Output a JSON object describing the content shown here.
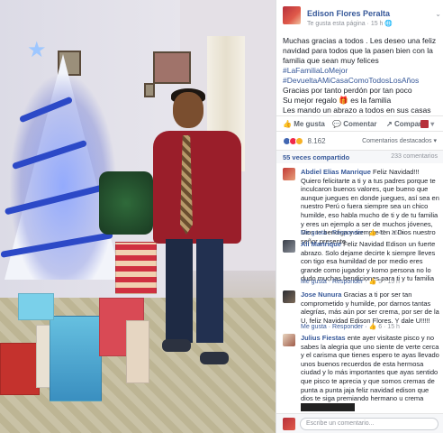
{
  "header": {
    "author": "Edison Flores Peralta",
    "meta": "Te gusta esta página · 15 h",
    "globe_icon": "globe-icon"
  },
  "post": {
    "line1": "Muchas gracias a todos . Les deseo una feliz navidad para todos que la pasen bien con la familia que sean muy felices",
    "hashtag1": "#LaFamiliaLoMejor",
    "hashtag2": "#DevueltaAMiCasaComoTodosLosAños",
    "line2": "Gracias por tanto perdón por tan poco",
    "line3": "Su mejor regalo 🎁 es la familia",
    "line4": "Les mando un abrazo a todos en sus casas"
  },
  "actions": {
    "like": "Me gusta",
    "comment": "Comentar",
    "share": "Compartir"
  },
  "reactions": {
    "count": "8.162",
    "sort_label": "Comentarios destacados"
  },
  "comments_bar": {
    "previous": "55 veces compartido",
    "count": "233 comentarios"
  },
  "comments": [
    {
      "name": "Abdiel Elias Manrique",
      "text": "Feliz Navidad!!! Quiero felicitarte a ti y a tus padres porque te inculcaron buenos valores, que bueno que aunque juegues en donde juegues, así sea en nuestro Perú o fuera siempre sea un chico humilde, eso habla mucho de ti y de tu familia y eres un ejemplo a ser de muchos jóvenes, Dios te bendiga y siempre ten a Dios nuestro señor presente",
      "like": "Me gusta",
      "reply": "Responder",
      "count": "49",
      "time": "15 h"
    },
    {
      "name": "Ali Manrique",
      "text": "Feliz Navidad Edison un fuerte abrazo. Solo dejame decirte k siempre lleves con tigo esa humildad de por medio eres grande como jugador y komo persona no lo dudo muchas bendiciones para ti y tu familia",
      "like": "Me gusta",
      "reply": "Responder",
      "count": "5",
      "time": "15 h"
    },
    {
      "name": "Jose Nunura",
      "text": "Gracias a ti por ser tan comprometido y humilde, por darnos tantas alegrías, más aún por ser crema, por ser de la U, feliz Navidad Edison Flores. Y dale U!!!!!",
      "like": "Me gusta",
      "reply": "Responder",
      "count": "6",
      "time": "15 h"
    },
    {
      "name": "Julius Fiestas",
      "text": "ente ayer visitaste pisco y no sabes la alegria que uno siente de verte cerca y el carisma que tienes espero te ayas llevado unos buenos recuerdos de esta hermosa ciudad y lo más importantes que ayas sentido que pisco te aprecia y que somos cremas de punta a punta jaja feliz navidad edison que dios te siga premiando hermano u crema"
    }
  ],
  "write": {
    "placeholder": "Escribe un comentario..."
  },
  "colors": {
    "link": "#365899",
    "like_reaction": "#4267b2",
    "love_reaction": "#f0284a",
    "haha_reaction": "#f7b125"
  }
}
